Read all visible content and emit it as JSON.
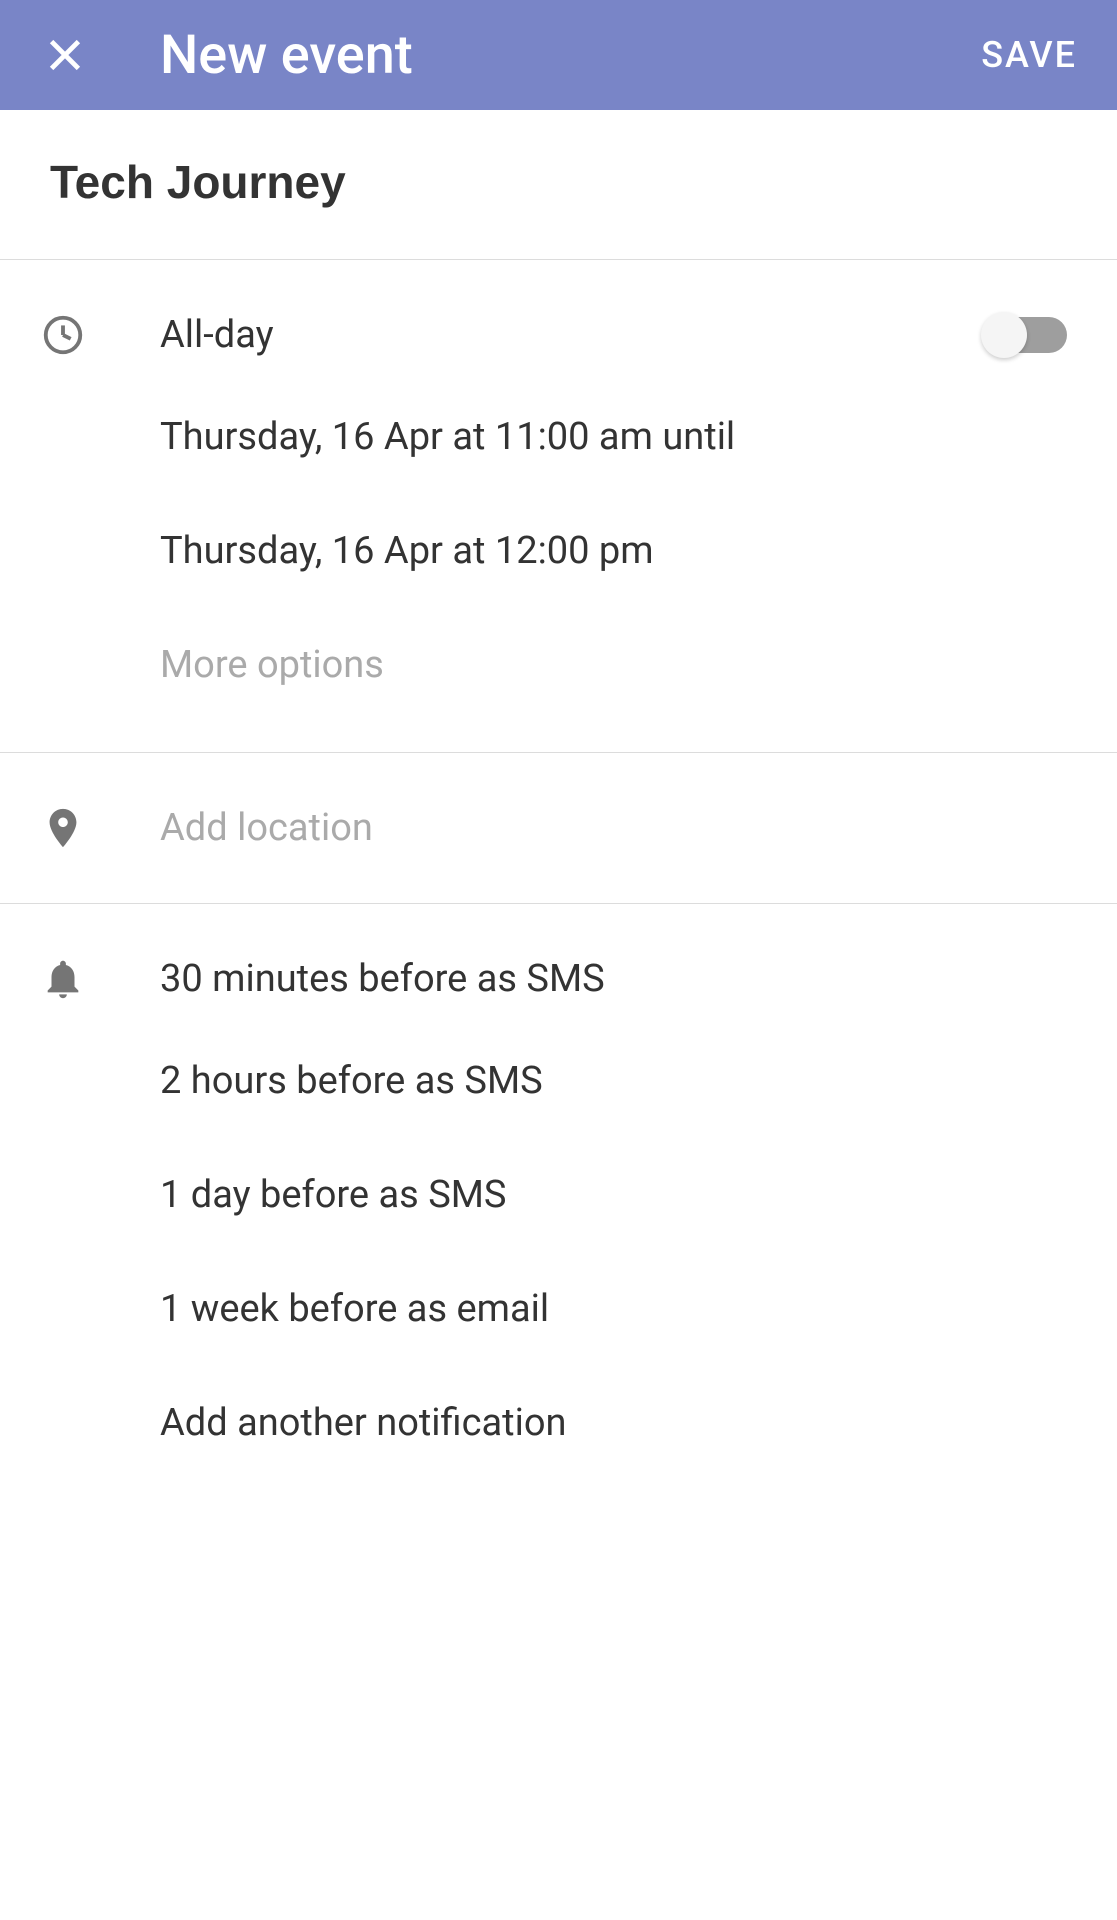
{
  "header": {
    "title": "New event",
    "save_label": "SAVE"
  },
  "event": {
    "title": "Tech Journey"
  },
  "time": {
    "allday_label": "All-day",
    "start": "Thursday, 16 Apr at 11:00 am until",
    "end": "Thursday, 16 Apr at 12:00 pm",
    "more_options": "More options"
  },
  "location": {
    "placeholder": "Add location"
  },
  "notifications": {
    "items": [
      "30 minutes before as SMS",
      "2 hours before as SMS",
      "1 day before as SMS",
      "1 week before as email"
    ],
    "add_another": "Add another notification"
  }
}
